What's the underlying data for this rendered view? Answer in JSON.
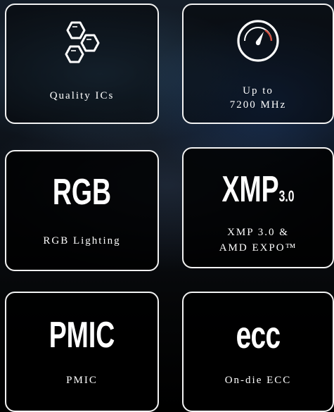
{
  "features": [
    {
      "id": "quality-ics",
      "label": "Quality ICs",
      "icon": "hexagon-cluster-icon"
    },
    {
      "id": "speed",
      "label_lines": [
        "Up to",
        "7200 MHz"
      ],
      "icon": "speedometer-icon"
    },
    {
      "id": "rgb",
      "badge": "RGB",
      "label": "RGB Lighting"
    },
    {
      "id": "xmp",
      "badge_main": "XMP",
      "badge_sub": "3.0",
      "label_lines": [
        "XMP 3.0 &",
        "AMD EXPO™"
      ]
    },
    {
      "id": "pmic",
      "badge": "PMIC",
      "label": "PMIC"
    },
    {
      "id": "ecc",
      "badge": "ecc",
      "label": "On-die ECC"
    }
  ],
  "colors": {
    "card_border": "#f2f2f2",
    "text": "#ffffff",
    "gauge_accent": "#d04a3a"
  }
}
